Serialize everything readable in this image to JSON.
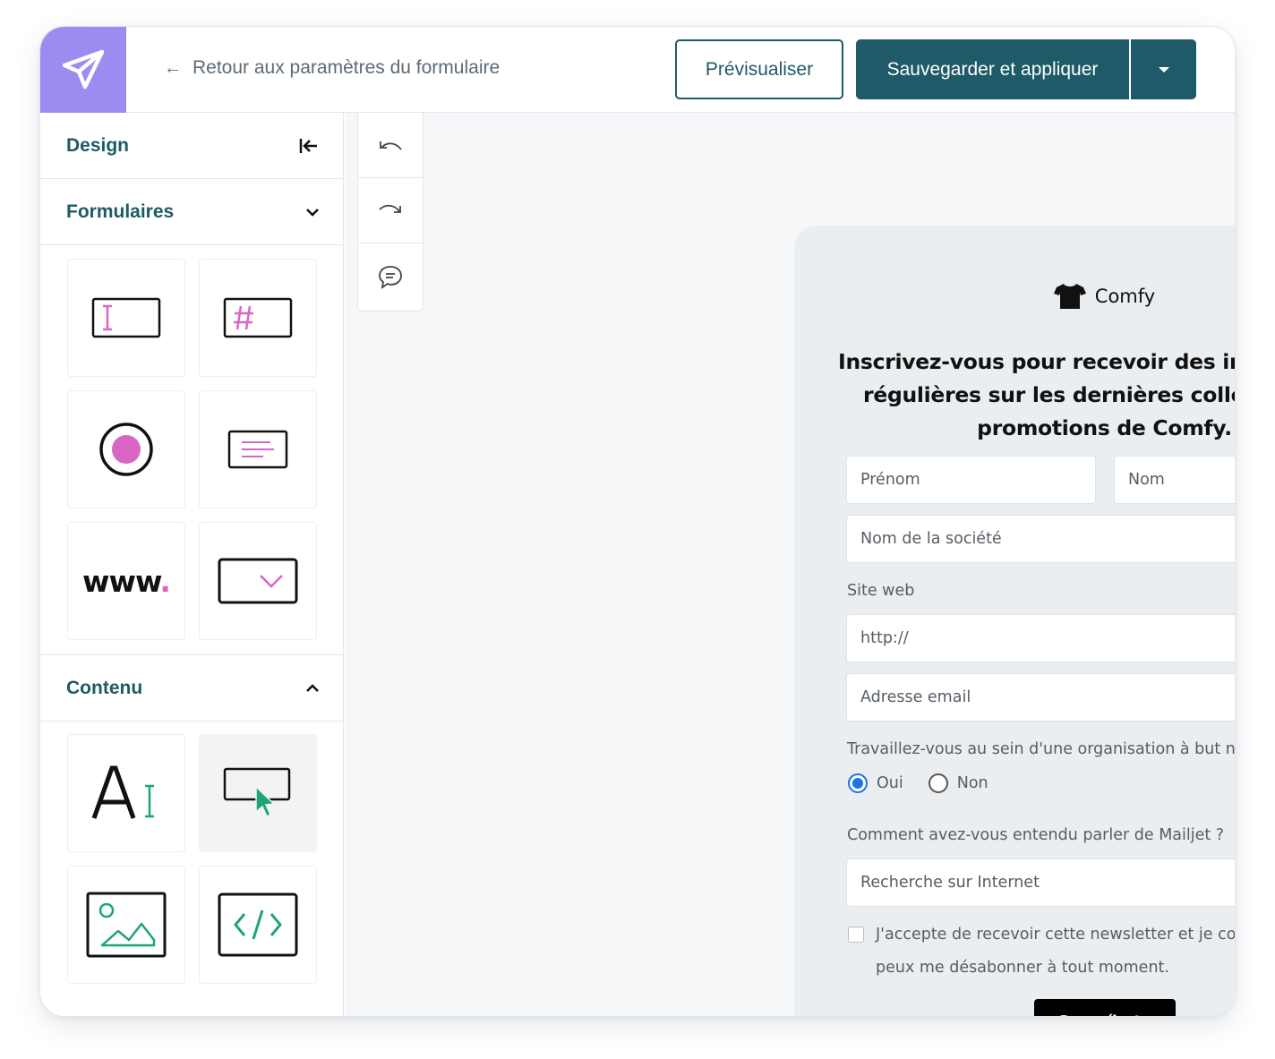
{
  "header": {
    "back_link": "Retour aux paramètres du formulaire",
    "preview_label": "Prévisualiser",
    "save_label": "Sauvegarder et appliquer"
  },
  "sidebar": {
    "design_title": "Design",
    "forms_title": "Formulaires",
    "content_title": "Contenu",
    "form_tiles": [
      "text-field-icon",
      "number-field-icon",
      "radio-icon",
      "textarea-icon",
      "url-field-icon",
      "dropdown-icon"
    ],
    "content_tiles": [
      "text-block-icon",
      "button-block-icon",
      "image-block-icon",
      "code-block-icon"
    ],
    "www_text": "www"
  },
  "toolbar": [
    "undo-icon",
    "redo-icon",
    "comment-icon"
  ],
  "form": {
    "brand": "Comfy",
    "headline": "Inscrivez-vous pour recevoir des informations régulières sur les dernières collections et promotions de Comfy.",
    "first_name": "Prénom",
    "last_name": "Nom",
    "company": "Nom de la société",
    "website_label": "Site web",
    "website_value": "http://",
    "email": "Adresse email",
    "nonprofit_question": "Travaillez-vous au sein d'une organisation à but non-lucratif .",
    "yes": "Oui",
    "no": "Non",
    "heard_question": "Comment avez-vous entendu parler de Mailjet ?",
    "heard_value": "Recherche sur Internet",
    "consent": "J'accepte de recevoir cette newsletter et je comprends que je peux me désabonner à tout moment.",
    "submit": "Suscríbete"
  },
  "colors": {
    "brand_teal": "#1e5a67",
    "logo_purple": "#9b8cf2",
    "accent_pink": "#d966c4",
    "accent_green": "#1ea672"
  }
}
